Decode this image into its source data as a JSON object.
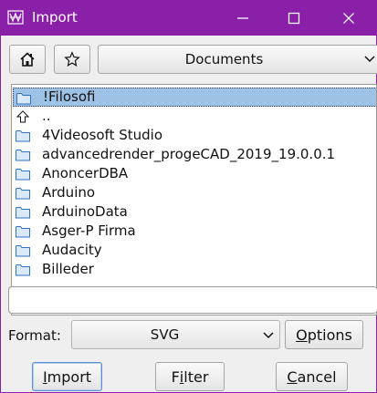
{
  "window": {
    "title": "Import",
    "title_color": "#ffffff",
    "frame_color": "#8a1fa8"
  },
  "toolbar": {
    "location": "Documents"
  },
  "file_list": {
    "selection_color": "#9ec1e6",
    "items": [
      {
        "label": "!Filosofi",
        "icon": "folder-icon",
        "selected": true
      },
      {
        "label": "..",
        "icon": "up-arrow-icon",
        "selected": false
      },
      {
        "label": "4Videosoft Studio",
        "icon": "folder-icon",
        "selected": false
      },
      {
        "label": "advancedrender_progeCAD_2019_19.0.0.1",
        "icon": "folder-icon",
        "selected": false
      },
      {
        "label": "AnoncerDBA",
        "icon": "folder-icon",
        "selected": false
      },
      {
        "label": "Arduino",
        "icon": "folder-icon",
        "selected": false
      },
      {
        "label": "ArduinoData",
        "icon": "folder-icon",
        "selected": false
      },
      {
        "label": "Asger-P Firma",
        "icon": "folder-icon",
        "selected": false
      },
      {
        "label": "Audacity",
        "icon": "folder-icon",
        "selected": false
      },
      {
        "label": "Billeder",
        "icon": "folder-icon",
        "selected": false
      }
    ]
  },
  "filename": {
    "value": "",
    "placeholder": ""
  },
  "format": {
    "label": "Format:",
    "selected": "SVG"
  },
  "buttons": {
    "options": {
      "mnemonic": "O",
      "rest": "ptions"
    },
    "import": {
      "mnemonic": "I",
      "rest": "mport"
    },
    "filter": {
      "first": "F",
      "mnemonic": "i",
      "rest": "lter"
    },
    "cancel": {
      "mnemonic": "C",
      "rest": "ancel"
    }
  }
}
